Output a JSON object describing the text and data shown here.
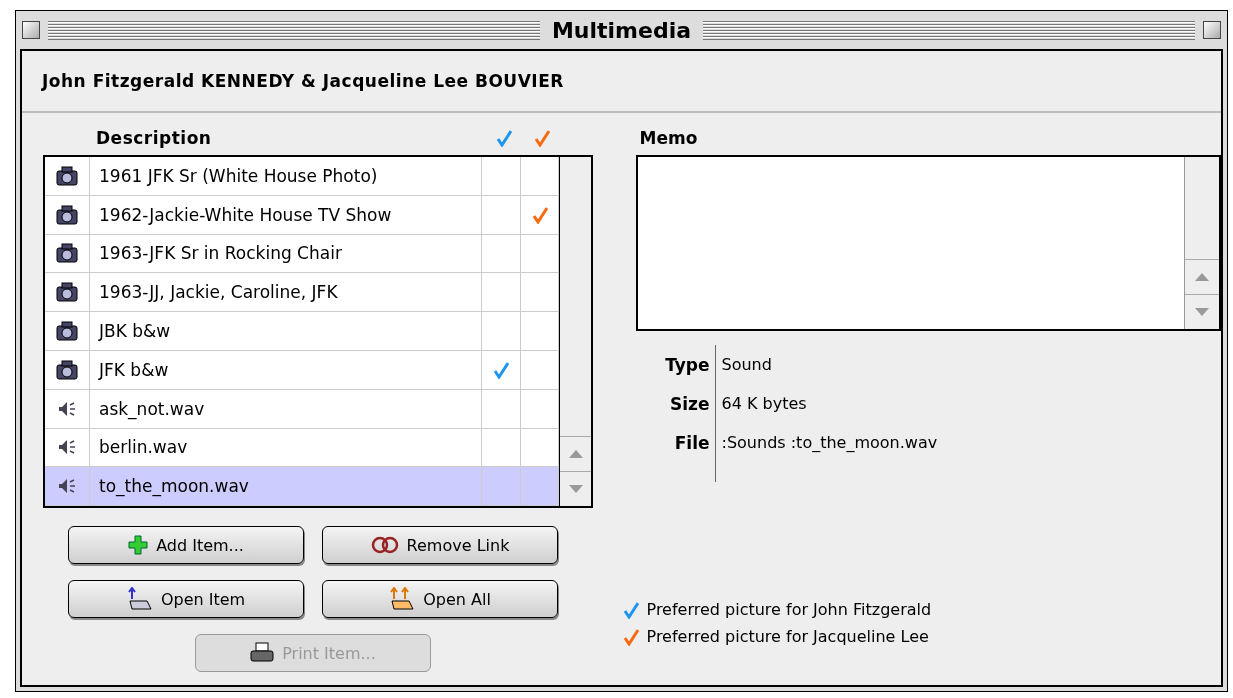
{
  "window": {
    "title": "Multimedia"
  },
  "header": "John Fitzgerald KENNEDY & Jacqueline Lee BOUVIER",
  "table": {
    "column_label": "Description",
    "rows": [
      {
        "kind": "photo",
        "description": "1961 JFK Sr (White House Photo)",
        "john": false,
        "jacqueline": false,
        "selected": false
      },
      {
        "kind": "photo",
        "description": "1962-Jackie-White House TV Show",
        "john": false,
        "jacqueline": true,
        "selected": false
      },
      {
        "kind": "photo",
        "description": "1963-JFK Sr in Rocking Chair",
        "john": false,
        "jacqueline": false,
        "selected": false
      },
      {
        "kind": "photo",
        "description": "1963-JJ, Jackie, Caroline, JFK",
        "john": false,
        "jacqueline": false,
        "selected": false
      },
      {
        "kind": "photo",
        "description": "JBK b&w",
        "john": false,
        "jacqueline": false,
        "selected": false
      },
      {
        "kind": "photo",
        "description": "JFK b&w",
        "john": true,
        "jacqueline": false,
        "selected": false
      },
      {
        "kind": "sound",
        "description": "ask_not.wav",
        "john": false,
        "jacqueline": false,
        "selected": false
      },
      {
        "kind": "sound",
        "description": "berlin.wav",
        "john": false,
        "jacqueline": false,
        "selected": false
      },
      {
        "kind": "sound",
        "description": "to_the_moon.wav",
        "john": false,
        "jacqueline": false,
        "selected": true
      }
    ]
  },
  "buttons": [
    {
      "kind": "add",
      "label": "Add Item...",
      "disabled": false
    },
    {
      "kind": "unlink",
      "label": "Remove Link",
      "disabled": false
    },
    {
      "kind": "open",
      "label": "Open Item",
      "disabled": false
    },
    {
      "kind": "open_all",
      "label": "Open All",
      "disabled": false
    },
    {
      "kind": "print",
      "label": "Print Item...",
      "disabled": true
    }
  ],
  "memo": {
    "label": "Memo"
  },
  "info": [
    {
      "label": "Type",
      "value": "Sound"
    },
    {
      "label": "Size",
      "value": "64 K bytes"
    },
    {
      "label": "File",
      "value": ":Sounds :to_the_moon.wav"
    }
  ],
  "legend": [
    {
      "text": "Preferred picture for John Fitzgerald",
      "color": "#1e96f0"
    },
    {
      "text": "Preferred picture for Jacqueline Lee",
      "color": "#f86a10"
    }
  ]
}
